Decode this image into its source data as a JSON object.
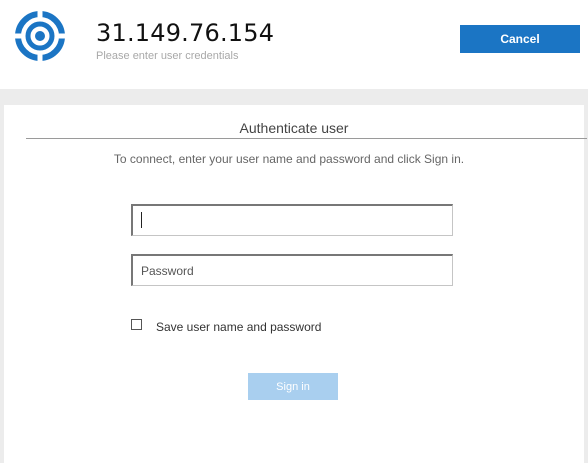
{
  "header": {
    "host": "31.149.76.154",
    "subtitle": "Please enter user credentials",
    "cancel_label": "Cancel",
    "logo_icon": "target-logo-icon",
    "accent_color": "#1b75c4"
  },
  "auth": {
    "title": "Authenticate user",
    "instructions": "To connect, enter your user name and password and click Sign in.",
    "username": {
      "value": "",
      "placeholder": ""
    },
    "password": {
      "value": "",
      "placeholder": "Password"
    },
    "save_credentials": {
      "label": "Save user name and password",
      "checked": false
    },
    "signin_label": "Sign in"
  }
}
